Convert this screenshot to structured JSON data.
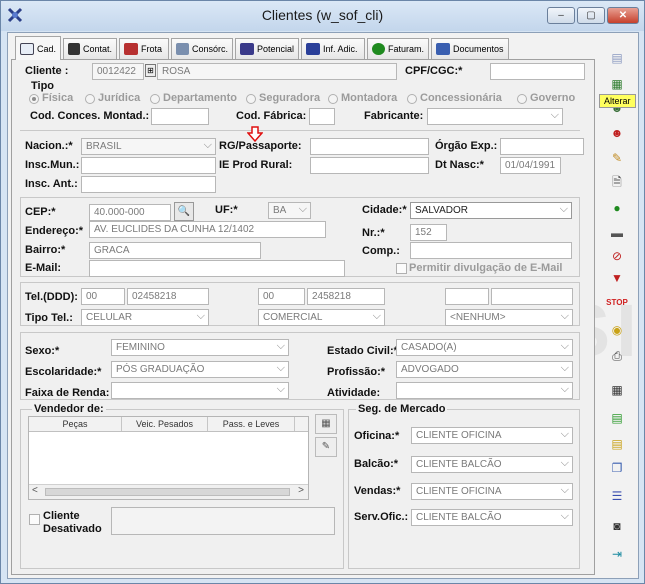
{
  "window": {
    "title": "Clientes (w_sof_cli)",
    "minimize": "–",
    "restore": "▢",
    "close": "✕"
  },
  "tabs": [
    {
      "label": "Cad.",
      "icon": "file-edit-icon"
    },
    {
      "label": "Contat.",
      "icon": "phone-icon"
    },
    {
      "label": "Frota",
      "icon": "tools-icon"
    },
    {
      "label": "Consórc.",
      "icon": "card-icon"
    },
    {
      "label": "Potencial",
      "icon": "calculator-icon"
    },
    {
      "label": "Inf. Adic.",
      "icon": "table-icon"
    },
    {
      "label": "Faturam.",
      "icon": "money-bag-icon"
    },
    {
      "label": "Documentos",
      "icon": "documents-icon"
    }
  ],
  "cliente": {
    "label": "Cliente :",
    "code": "0012422",
    "name": "ROSA",
    "cpf_label": "CPF/CGC:*",
    "cpf_value": ""
  },
  "tipo": {
    "label": "Tipo",
    "options": [
      "Física",
      "Jurídica",
      "Departamento",
      "Seguradora",
      "Montadora",
      "Concessionária",
      "Governo"
    ],
    "selected": "Física"
  },
  "concess": {
    "cod_label": "Cod. Conces. Montad.:",
    "fabrica_label": "Cod. Fábrica:",
    "fabricante_label": "Fabricante:"
  },
  "pessoal": {
    "nacion_label": "Nacion.:*",
    "nacion_value": "BRASIL",
    "rg_label": "RG/Passaporte:",
    "orgao_label": "Órgão Exp.:",
    "insc_mun_label": "Insc.Mun.:",
    "ie_label": "IE Prod Rural:",
    "dt_nasc_label": "Dt Nasc:*",
    "dt_nasc_value": "01/04/1991",
    "insc_ant_label": "Insc. Ant.:"
  },
  "endereco": {
    "cep_label": "CEP:*",
    "cep_value": "40.000-000",
    "uf_label": "UF:*",
    "uf_value": "BA",
    "cidade_label": "Cidade:*",
    "cidade_value": "SALVADOR",
    "endereco_label": "Endereço:*",
    "endereco_value": "AV. EUCLIDES DA CUNHA 12/1402",
    "nr_label": "Nr.:*",
    "nr_value": "152",
    "bairro_label": "Bairro:*",
    "bairro_value": "GRACA",
    "comp_label": "Comp.:",
    "email_label": "E-Mail:",
    "email_permit": "Permitir divulgação de E-Mail"
  },
  "telefone": {
    "label": "Tel.(DDD):",
    "ddd1": "00",
    "num1": "02458218",
    "ddd2": "00",
    "num2": "2458218",
    "tipo_label": "Tipo Tel.:",
    "tipo1": "CELULAR",
    "tipo2": "COMERCIAL",
    "tipo3": "<NENHUM>"
  },
  "perfil": {
    "sexo_label": "Sexo:*",
    "sexo_value": "FEMININO",
    "civil_label": "Estado Civil:*",
    "civil_value": "CASADO(A)",
    "escol_label": "Escolaridade:*",
    "escol_value": "PÓS GRADUAÇÃO",
    "prof_label": "Profissão:*",
    "prof_value": "ADVOGADO",
    "renda_label": "Faixa de Renda:",
    "ativ_label": "Atividade:"
  },
  "vendedor": {
    "label": "Vendedor de:",
    "columns": [
      "Peças",
      "Veic. Pesados",
      "Pass. e Leves"
    ]
  },
  "cliente_desativado": "Cliente Desativado",
  "seg_mercado": {
    "label": "Seg. de Mercado",
    "oficina_label": "Oficina:*",
    "oficina_value": "CLIENTE OFICINA",
    "balcao_label": "Balcão:*",
    "balcao_value": "CLIENTE BALCÃO",
    "vendas_label": "Vendas:*",
    "vendas_value": "CLIENTE OFICINA",
    "servofic_label": "Serv.Ofic.:",
    "servofic_value": "CLIENTE BALCÃO"
  },
  "watermark": "DEMO VERSION",
  "tooltip": "Alterar",
  "toolbar_icons": [
    "new-record-icon",
    "edit-table-icon",
    "user-icon",
    "user-red-icon",
    "eraser-icon",
    "print-preview-icon",
    "money-icon",
    "car-icon",
    "stop-note-icon",
    "thumbs-down-icon",
    "stop-icon",
    "coins-icon",
    "printer-icon",
    "calendar-icon",
    "doc-green-icon",
    "doc-yellow-icon",
    "copy-icon",
    "list-icon",
    "camera-icon",
    "exit-icon"
  ]
}
